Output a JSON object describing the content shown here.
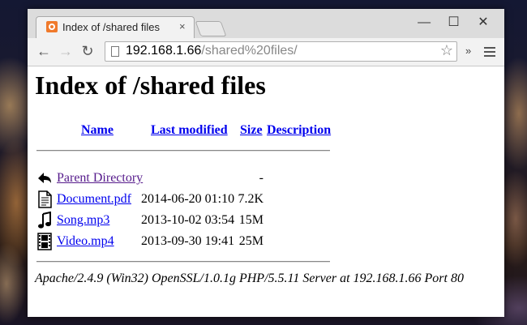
{
  "browser": {
    "tab_title": "Index of /shared files",
    "tab_close": "×",
    "url_host": "192.168.1.66",
    "url_path": "/shared%20files/",
    "extend_label": "»",
    "controls": {
      "minimize": "—",
      "maximize": "☐",
      "close": "✕"
    },
    "nav": {
      "back": "←",
      "forward": "→",
      "reload": "↻"
    },
    "star": "☆"
  },
  "page": {
    "heading": "Index of /shared files",
    "columns": {
      "name": "Name",
      "last_modified": "Last modified",
      "size": "Size",
      "description": "Description"
    },
    "rows": [
      {
        "icon": "back-arrow-icon",
        "name": "Parent Directory",
        "date": "",
        "size": "-"
      },
      {
        "icon": "document-icon",
        "name": "Document.pdf",
        "date": "2014-06-20 01:10",
        "size": "7.2K"
      },
      {
        "icon": "music-note-icon",
        "name": "Song.mp3",
        "date": "2013-10-02 03:54",
        "size": "15M"
      },
      {
        "icon": "film-icon",
        "name": "Video.mp4",
        "date": "2013-09-30 19:41",
        "size": "25M"
      }
    ],
    "footer": "Apache/2.4.9 (Win32) OpenSSL/1.0.1g PHP/5.5.11 Server at 192.168.1.66 Port 80"
  },
  "colors": {
    "link": "#0000ee",
    "visited": "#551a8b",
    "favicon": "#f07a2c"
  }
}
